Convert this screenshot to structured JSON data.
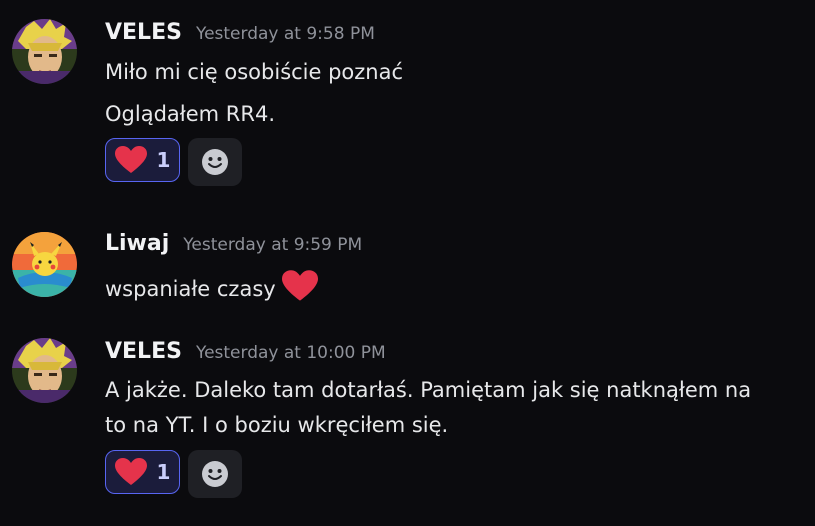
{
  "messages": [
    {
      "username": "VELES",
      "timestamp": "Yesterday at 9:58 PM",
      "lines": [
        "Miło mi cię osobiście poznać",
        "Oglądałem RR4."
      ],
      "reaction": {
        "emoji": "heart-icon",
        "count": "1"
      }
    },
    {
      "username": "Liwaj",
      "timestamp": "Yesterday at 9:59 PM",
      "lines": [
        "wspaniałe czasy"
      ],
      "inline_emoji": "heart-icon"
    },
    {
      "username": "VELES",
      "timestamp": "Yesterday at 10:00 PM",
      "lines": [
        "A jakże. Daleko tam dotarłaś. Pamiętam jak się natknąłem na",
        "to na YT. I o boziu wkręciłem się."
      ],
      "reaction": {
        "emoji": "heart-icon",
        "count": "1"
      }
    }
  ],
  "colors": {
    "background": "#0b0b0e",
    "reaction_bg": "#1b1c3b",
    "reaction_border": "#5865f2",
    "heart": "#e5334b"
  }
}
